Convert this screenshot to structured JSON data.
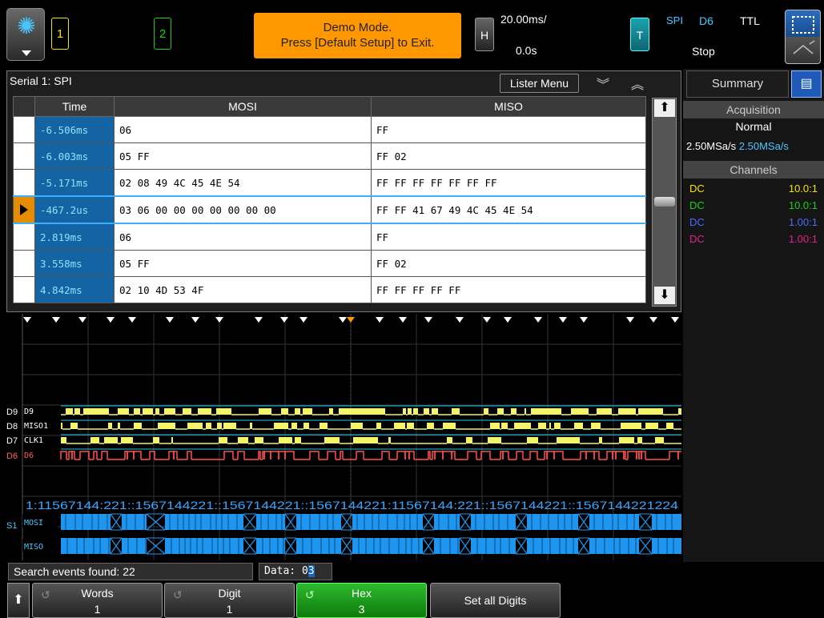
{
  "top": {
    "ch1_label": "1",
    "ch2_label": "2",
    "demo_line1": "Demo Mode.",
    "demo_line2": "Press [Default Setup] to Exit.",
    "horiz_btn": "H",
    "timescale": "20.00ms/",
    "delay": "0.0s",
    "trig_btn": "T",
    "trig_type": "SPI",
    "trig_channel": "D6",
    "trig_level": "TTL",
    "run_state": "Stop"
  },
  "lister": {
    "title": "Serial 1: SPI",
    "menu_label": "Lister Menu",
    "columns": [
      "Time",
      "MOSI",
      "MISO"
    ],
    "rows": [
      {
        "time": "-6.506ms",
        "mosi": "06",
        "miso": "FF"
      },
      {
        "time": "-6.003ms",
        "mosi": "05 FF",
        "miso": "FF 02"
      },
      {
        "time": "-5.171ms",
        "mosi": "02 08 49 4C 45 4E 54",
        "miso": "FF FF FF FF FF FF FF"
      },
      {
        "time": "-467.2us",
        "mosi": "03 06 00 00 00 00 00 00 00",
        "miso": "FF FF 41 67 49 4C 45 4E 54"
      },
      {
        "time": "2.819ms",
        "mosi": "06",
        "miso": "FF"
      },
      {
        "time": "3.558ms",
        "mosi": "05 FF",
        "miso": "FF 02"
      },
      {
        "time": "4.842ms",
        "mosi": "02 10 4D 53 4F",
        "miso": "FF FF FF FF FF"
      }
    ],
    "selected_row": 3
  },
  "panel": {
    "tab_summary": "Summary",
    "acq_header": "Acquisition",
    "acq_mode": "Normal",
    "acq_rate_1": "2.50MSa/s",
    "acq_rate_2": "2.50MSa/s",
    "channels_header": "Channels",
    "channels": [
      {
        "coupling": "DC",
        "probe": "10.0:1",
        "color": "#f4e500"
      },
      {
        "coupling": "DC",
        "probe": "10.0:1",
        "color": "#19d219"
      },
      {
        "coupling": "DC",
        "probe": "1.00:1",
        "color": "#4a6cff"
      },
      {
        "coupling": "DC",
        "probe": "1.00:1",
        "color": "#e0238a"
      }
    ]
  },
  "waveform": {
    "digital": [
      {
        "label": "D9",
        "color": "#f4f46a"
      },
      {
        "label": "MISO1",
        "color": "#f4f46a"
      },
      {
        "label": "CLK1",
        "color": "#f4f46a"
      },
      {
        "label": "D6",
        "color": "#ff5050"
      }
    ],
    "channel_tags": [
      "D9",
      "D8",
      "D7",
      "D6"
    ],
    "serial_tag": "S1",
    "bus_labels": [
      "MOSI",
      "MISO"
    ],
    "decode_text": "1:11567144:221::1567144221::1567144221::1567144221:11567144:221::1567144221::1567144221224"
  },
  "bottom": {
    "search_text": "Search events found: 22",
    "data_label": "Data: 0",
    "data_cursor": "3",
    "softkeys": [
      {
        "title": "Words",
        "value": "1"
      },
      {
        "title": "Digit",
        "value": "1"
      },
      {
        "title": "Hex",
        "value": "3"
      },
      {
        "title": "Set all Digits",
        "value": ""
      }
    ]
  }
}
